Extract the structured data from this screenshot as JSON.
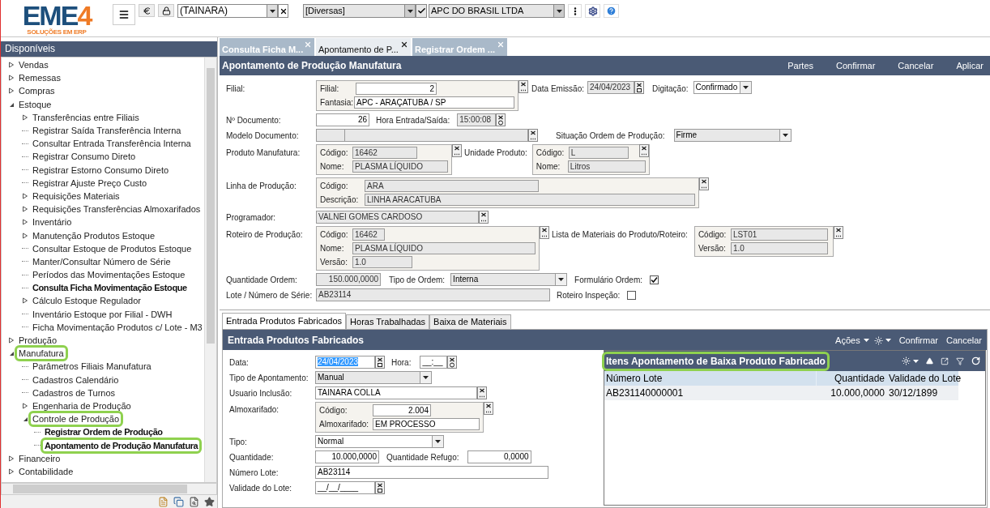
{
  "header": {
    "logo": {
      "name": "EME",
      "digit": "4",
      "tagline": "SOLUÇÕES EM ERP"
    },
    "user": "(TAINARA)",
    "category": "[Diversas]",
    "company": "APC DO BRASIL LTDA"
  },
  "sidebar": {
    "title": "Disponíveis",
    "tree": [
      {
        "label": "Vendas",
        "kind": "folder",
        "expanded": false,
        "opened": false,
        "highlighted": false
      },
      {
        "label": "Remessas",
        "kind": "folder",
        "expanded": false,
        "opened": false,
        "highlighted": false
      },
      {
        "label": "Compras",
        "kind": "folder",
        "expanded": false,
        "opened": false,
        "highlighted": false
      },
      {
        "label": "Estoque",
        "kind": "folder",
        "expanded": true,
        "opened": false,
        "highlighted": false,
        "children": [
          {
            "label": "Transferências entre Filiais",
            "kind": "folder",
            "expanded": false,
            "opened": false,
            "highlighted": false
          },
          {
            "label": "Registrar Saída Transferência Interna",
            "kind": "leaf",
            "opened": false,
            "highlighted": false
          },
          {
            "label": "Consultar Entrada Transferência Interna",
            "kind": "leaf",
            "opened": false,
            "highlighted": false
          },
          {
            "label": "Registrar Consumo Direto",
            "kind": "leaf",
            "opened": false,
            "highlighted": false
          },
          {
            "label": "Registrar Estorno Consumo Direto",
            "kind": "leaf",
            "opened": false,
            "highlighted": false
          },
          {
            "label": "Registrar Ajuste Preço Custo",
            "kind": "leaf",
            "opened": false,
            "highlighted": false
          },
          {
            "label": "Requisições Materiais",
            "kind": "folder",
            "expanded": false,
            "opened": false,
            "highlighted": false
          },
          {
            "label": "Requisições Transferências Almoxarifados",
            "kind": "folder",
            "expanded": false,
            "opened": false,
            "highlighted": false
          },
          {
            "label": "Inventário",
            "kind": "folder",
            "expanded": false,
            "opened": false,
            "highlighted": false
          },
          {
            "label": "Manutenção Produtos Estoque",
            "kind": "folder",
            "expanded": false,
            "opened": false,
            "highlighted": false
          },
          {
            "label": "Consultar Estoque de Produtos Estoque",
            "kind": "leaf",
            "opened": false,
            "highlighted": false
          },
          {
            "label": "Manter/Consultar Número de Série",
            "kind": "leaf",
            "opened": false,
            "highlighted": false
          },
          {
            "label": "Períodos das Movimentações Estoque",
            "kind": "leaf",
            "opened": false,
            "highlighted": false
          },
          {
            "label": "Consulta Ficha Movimentação Estoque",
            "kind": "leaf",
            "opened": true,
            "highlighted": false
          },
          {
            "label": "Cálculo Estoque Regulador",
            "kind": "folder",
            "expanded": false,
            "opened": false,
            "highlighted": false
          },
          {
            "label": "Inventário Estoque por Filial - DWH",
            "kind": "leaf",
            "opened": false,
            "highlighted": false
          },
          {
            "label": "Ficha Movimentação Produtos c/ Lote - M3",
            "kind": "leaf",
            "opened": false,
            "highlighted": false
          }
        ]
      },
      {
        "label": "Produção",
        "kind": "folder",
        "expanded": false,
        "opened": false,
        "highlighted": false
      },
      {
        "label": "Manufatura",
        "kind": "folder",
        "expanded": true,
        "opened": false,
        "highlighted": true,
        "children": [
          {
            "label": "Parâmetros Filiais Manufatura",
            "kind": "leaf",
            "opened": false,
            "highlighted": false
          },
          {
            "label": "Cadastros Calendário",
            "kind": "leaf",
            "opened": false,
            "highlighted": false
          },
          {
            "label": "Cadastros de Turnos",
            "kind": "leaf",
            "opened": false,
            "highlighted": false
          },
          {
            "label": "Engenharia de Produção",
            "kind": "folder",
            "expanded": false,
            "opened": false,
            "highlighted": false
          },
          {
            "label": "Controle de Produção",
            "kind": "folder",
            "expanded": true,
            "opened": false,
            "highlighted": true,
            "children": [
              {
                "label": "Registrar Ordem de Produção",
                "kind": "leaf",
                "opened": true,
                "highlighted": false
              },
              {
                "label": "Apontamento de Produção Manufatura",
                "kind": "leaf",
                "opened": true,
                "highlighted": true
              }
            ]
          }
        ]
      },
      {
        "label": "Financeiro",
        "kind": "folder",
        "expanded": false,
        "opened": false,
        "highlighted": false
      },
      {
        "label": "Contabilidade",
        "kind": "folder",
        "expanded": false,
        "opened": false,
        "highlighted": false
      }
    ]
  },
  "tabs": [
    {
      "label": "Consulta Ficha M...",
      "selected": false
    },
    {
      "label": "Apontamento de P...",
      "selected": true
    },
    {
      "label": "Registrar Ordem ...",
      "selected": false
    }
  ],
  "form": {
    "title": "Apontamento de Produção Manufatura",
    "actions": [
      "Partes",
      "Confirmar",
      "Cancelar",
      "Aplicar"
    ],
    "filial": {
      "label": "Filial:",
      "fields": [
        {
          "label": "Filial:",
          "value": "2",
          "readonly": false
        },
        {
          "label": "Fantasia:",
          "value": "APC - ARAÇATUBA / SP",
          "readonly": false
        }
      ]
    },
    "data_emissao": {
      "label": "Data Emissão:",
      "value": "24/04/2023",
      "readonly": true
    },
    "digitacao": {
      "label": "Digitação:",
      "value": "Confirmado",
      "readonly": false
    },
    "documento": {
      "label": "Nº Documento:",
      "value": "26",
      "readonly": false
    },
    "hora": {
      "label": "Hora Entrada/Saída:",
      "value": "15:00:08",
      "readonly": true
    },
    "modelo": {
      "label": "Modelo Documento:",
      "readonly": true
    },
    "situacao": {
      "label": "Situação Ordem de Produção:",
      "value": "Firme",
      "readonly": true
    },
    "produto": {
      "label": "Produto Manufatura:",
      "fields": [
        {
          "label": "Código:",
          "value": "16462",
          "readonly": true
        },
        {
          "label": "Nome:",
          "value": "PLASMA LÍQUIDO",
          "readonly": true
        }
      ]
    },
    "unidade": {
      "label": "Unidade Produto:",
      "fields": [
        {
          "label": "Código:",
          "value": "L",
          "readonly": true
        },
        {
          "label": "Nome:",
          "value": "Litros",
          "readonly": true
        }
      ]
    },
    "linha": {
      "label": "Linha de Produção:",
      "fields": [
        {
          "label": "Código:",
          "value": "ARA",
          "readonly": true
        },
        {
          "label": "Descrição:",
          "value": "LINHA ARACATUBA",
          "readonly": true
        }
      ]
    },
    "programador": {
      "label": "Programador:",
      "value": "VALNEI GOMES CARDOSO",
      "readonly": true
    },
    "roteiro": {
      "label": "Roteiro de Produção:",
      "fields": [
        {
          "label": "Código:",
          "value": "16462",
          "readonly": true
        },
        {
          "label": "Nome:",
          "value": "PLASMA LÍQUIDO",
          "readonly": true
        },
        {
          "label": "Versão:",
          "value": "1.0",
          "readonly": true
        }
      ]
    },
    "lista": {
      "label": "Lista de Materiais do Produto/Roteiro:",
      "fields": [
        {
          "label": "Código:",
          "value": "LST01",
          "readonly": true
        },
        {
          "label": "Versão:",
          "value": "1.0",
          "readonly": true
        }
      ]
    },
    "quantidade": {
      "label": "Quantidade Ordem:",
      "value": "150.000,0000",
      "readonly": true
    },
    "tipo_ordem": {
      "label": "Tipo de Ordem:",
      "value": "Interna",
      "readonly": true
    },
    "formulario": {
      "label": "Formulário Ordem:",
      "checked": true
    },
    "lote": {
      "label": "Lote /  Número de Série:",
      "value": "AB23114",
      "readonly": true
    },
    "inspecao": {
      "label": "Roteiro Inspeção:",
      "checked": false
    }
  },
  "detail": {
    "tabs": [
      {
        "label": "Entrada Produtos Fabricados",
        "selected": true
      },
      {
        "label": "Horas Trabalhadas",
        "selected": false
      },
      {
        "label": "Baixa de Materiais",
        "selected": false
      }
    ],
    "title": "Entrada Produtos Fabricados",
    "menu": "Ações",
    "buttons": [
      "Confirmar",
      "Cancelar"
    ],
    "data": {
      "label": "Data:",
      "value": "24/04/2023",
      "readonly": false,
      "text_selected": true
    },
    "hora": {
      "label": "Hora:",
      "value": "__:__",
      "readonly": false
    },
    "tipo_apontamento": {
      "label": "Tipo de Apontamento:",
      "value": "Manual",
      "readonly": true
    },
    "usuario": {
      "label": "Usuario Inclusão:",
      "value": "TAINARA COLLA",
      "readonly": false
    },
    "almoxarifado": {
      "label": "Almoxarifado:",
      "fields": [
        {
          "label": "Código:",
          "value": "2.004",
          "readonly": false
        },
        {
          "label": "Almoxarifado:",
          "value": "EM PROCESSO",
          "readonly": false
        }
      ]
    },
    "tipo": {
      "label": "Tipo:",
      "value": "Normal",
      "readonly": false
    },
    "quantidade": {
      "label": "Quantidade:",
      "value": "10.000,0000",
      "readonly": false
    },
    "refugo": {
      "label": "Quantidade Refugo:",
      "value": "0,0000",
      "readonly": false
    },
    "numero_lote": {
      "label": "Número Lote:",
      "value": "AB23114",
      "readonly": false
    },
    "validade": {
      "label": "Validade do Lote:",
      "value": "__/__/____",
      "readonly": false
    },
    "grid": {
      "title": "Itens Apontamento de Baixa Produto Fabricado",
      "highlighted": true,
      "columns": [
        "Número Lote",
        "Quantidade",
        "Validade do Lote"
      ],
      "rows": [
        [
          "AB231140000001",
          "10.000,0000",
          "30/12/1899"
        ]
      ]
    }
  }
}
